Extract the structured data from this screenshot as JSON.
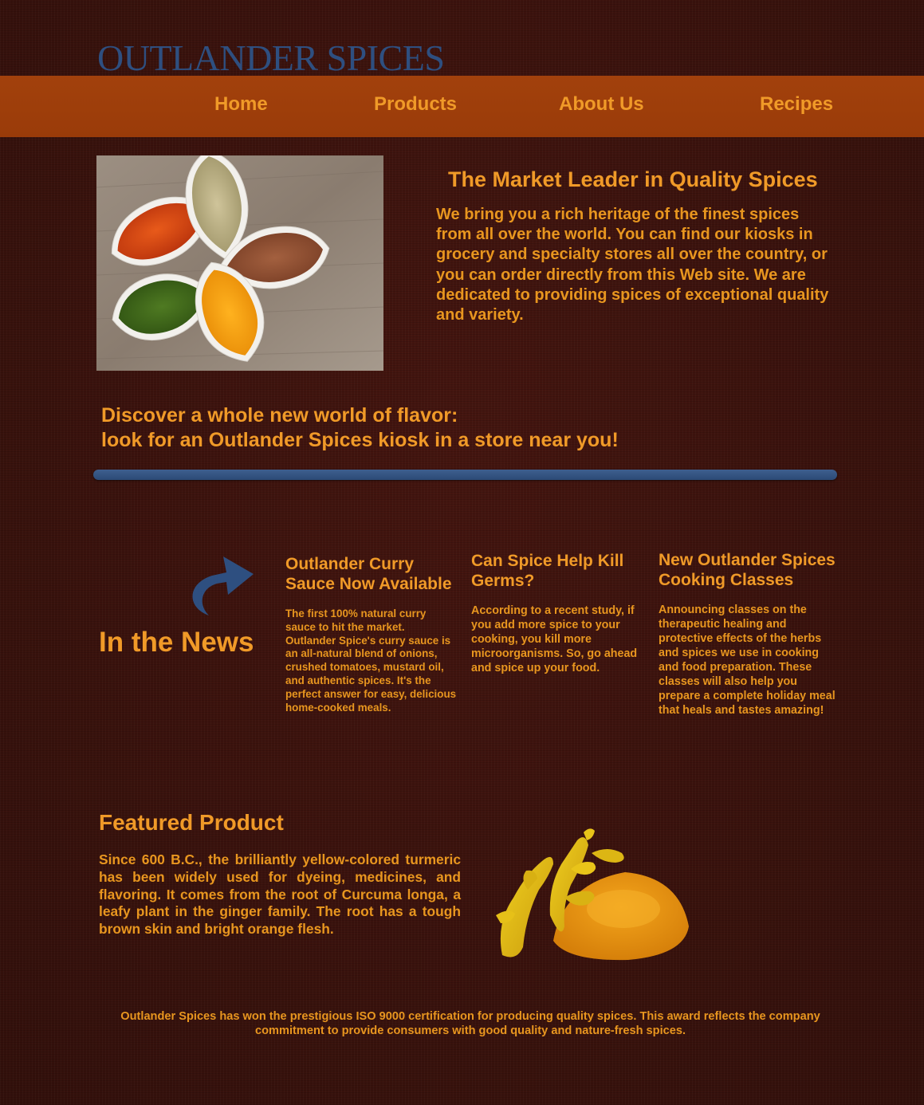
{
  "brand": {
    "logo_text": "OUTLANDER SPICES"
  },
  "nav": {
    "items": [
      {
        "label": "Home"
      },
      {
        "label": "Products"
      },
      {
        "label": "About Us"
      },
      {
        "label": "Recipes"
      }
    ]
  },
  "hero": {
    "image_icon": "spice-bowls-photo",
    "title": "The Market Leader in Quality Spices",
    "text": "We bring you a rich heritage of the finest spices from all over the world. You can find our kiosks in grocery and specialty stores all over the country, or you can order directly from this Web site. We are dedicated to providing spices of exceptional quality and variety."
  },
  "discover": {
    "line1": "Discover a whole new world of flavor:",
    "line2": "look for an Outlander Spices kiosk in a store near you!"
  },
  "news": {
    "heading": "In the News",
    "arrow_icon": "curved-arrow-icon",
    "articles": [
      {
        "title": "Outlander Curry Sauce Now Available",
        "body": "The first 100% natural curry sauce to hit the market. Outlander Spice's curry sauce is an all-natural blend of onions, crushed tomatoes, mustard oil, and authentic spices. It's the perfect answer for easy, delicious home-cooked meals."
      },
      {
        "title": "Can Spice Help Kill Germs?",
        "body": "According to a recent study, if you add more spice to your cooking, you kill more microorganisms. So, go ahead and spice up your food."
      },
      {
        "title": "New Outlander Spices Cooking Classes",
        "body": "Announcing classes on the therapeutic healing and protective effects of the herbs and spices we use in cooking and food preparation. These classes will also help you prepare a complete holiday meal that heals and tastes amazing!"
      }
    ]
  },
  "featured": {
    "title": "Featured Product",
    "text": "Since 600 B.C., the brilliantly yellow-colored turmeric has been widely used for dyeing, medicines, and flavoring. It comes from the root of Curcuma longa, a leafy plant in the ginger family. The root has a tough brown skin and bright orange flesh.",
    "image_icon": "turmeric-root-photo"
  },
  "footer": {
    "text": "Outlander Spices has won the prestigious ISO 9000 certification for producing quality spices. This award reflects the company commitment to provide consumers with good quality and nature-fresh spices."
  },
  "colors": {
    "background": "#3a110c",
    "nav_bar": "#a0400b",
    "accent_text": "#f09a28",
    "logo_blue": "#2e4f80",
    "divider_blue": "#34547f"
  }
}
